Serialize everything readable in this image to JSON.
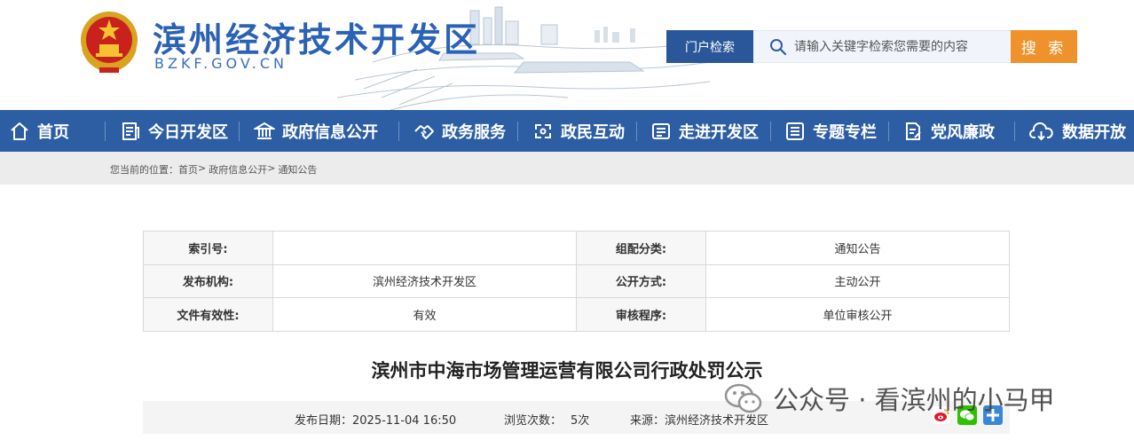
{
  "header": {
    "site_title": "滨州经济技术开发区",
    "site_domain": "BZKF.GOV.CN",
    "search_scope": "门户检索",
    "search_placeholder": "请输入关键字检索您需要的内容",
    "search_button": "搜 索"
  },
  "nav": {
    "items": [
      {
        "label": "首页",
        "icon": "home-icon"
      },
      {
        "label": "今日开发区",
        "icon": "newspaper-icon"
      },
      {
        "label": "政府信息公开",
        "icon": "government-building-icon"
      },
      {
        "label": "政务服务",
        "icon": "handshake-icon"
      },
      {
        "label": "政民互动",
        "icon": "interaction-icon"
      },
      {
        "label": "走进开发区",
        "icon": "profile-card-icon"
      },
      {
        "label": "专题专栏",
        "icon": "list-icon"
      },
      {
        "label": "党风廉政",
        "icon": "document-pen-icon"
      },
      {
        "label": "数据开放",
        "icon": "cloud-download-icon"
      }
    ]
  },
  "breadcrumb": {
    "prefix": "您当前的位置：",
    "items": [
      "首页",
      "政府信息公开",
      "通知公告"
    ],
    "separator": ">"
  },
  "info_table": {
    "rows": [
      {
        "k1": "索引号:",
        "v1": "",
        "k2": "组配分类:",
        "v2": "通知公告"
      },
      {
        "k1": "发布机构:",
        "v1": "滨州经济技术开发区",
        "k2": "公开方式:",
        "v2": "主动公开"
      },
      {
        "k1": "文件有效性:",
        "v1": "有效",
        "k2": "审核程序:",
        "v2": "单位审核公开"
      }
    ]
  },
  "document": {
    "title": "滨州市中海市场管理运营有限公司行政处罚公示",
    "publish_date": "发布日期：2025-11-04 16:50",
    "views_label": "浏览次数：",
    "views_value": "5次",
    "source": "来源：滨州经济技术开发区"
  },
  "share": {
    "icons": [
      "weibo-share-icon",
      "wechat-share-icon",
      "more-share-icon"
    ]
  },
  "watermark": {
    "text": "公众号 · 看滨州的小马甲"
  },
  "colors": {
    "nav_bg": "#2d5ea3",
    "title_blue": "#2b62b5",
    "search_button": "#f0922c",
    "search_scope": "#2a579a"
  }
}
